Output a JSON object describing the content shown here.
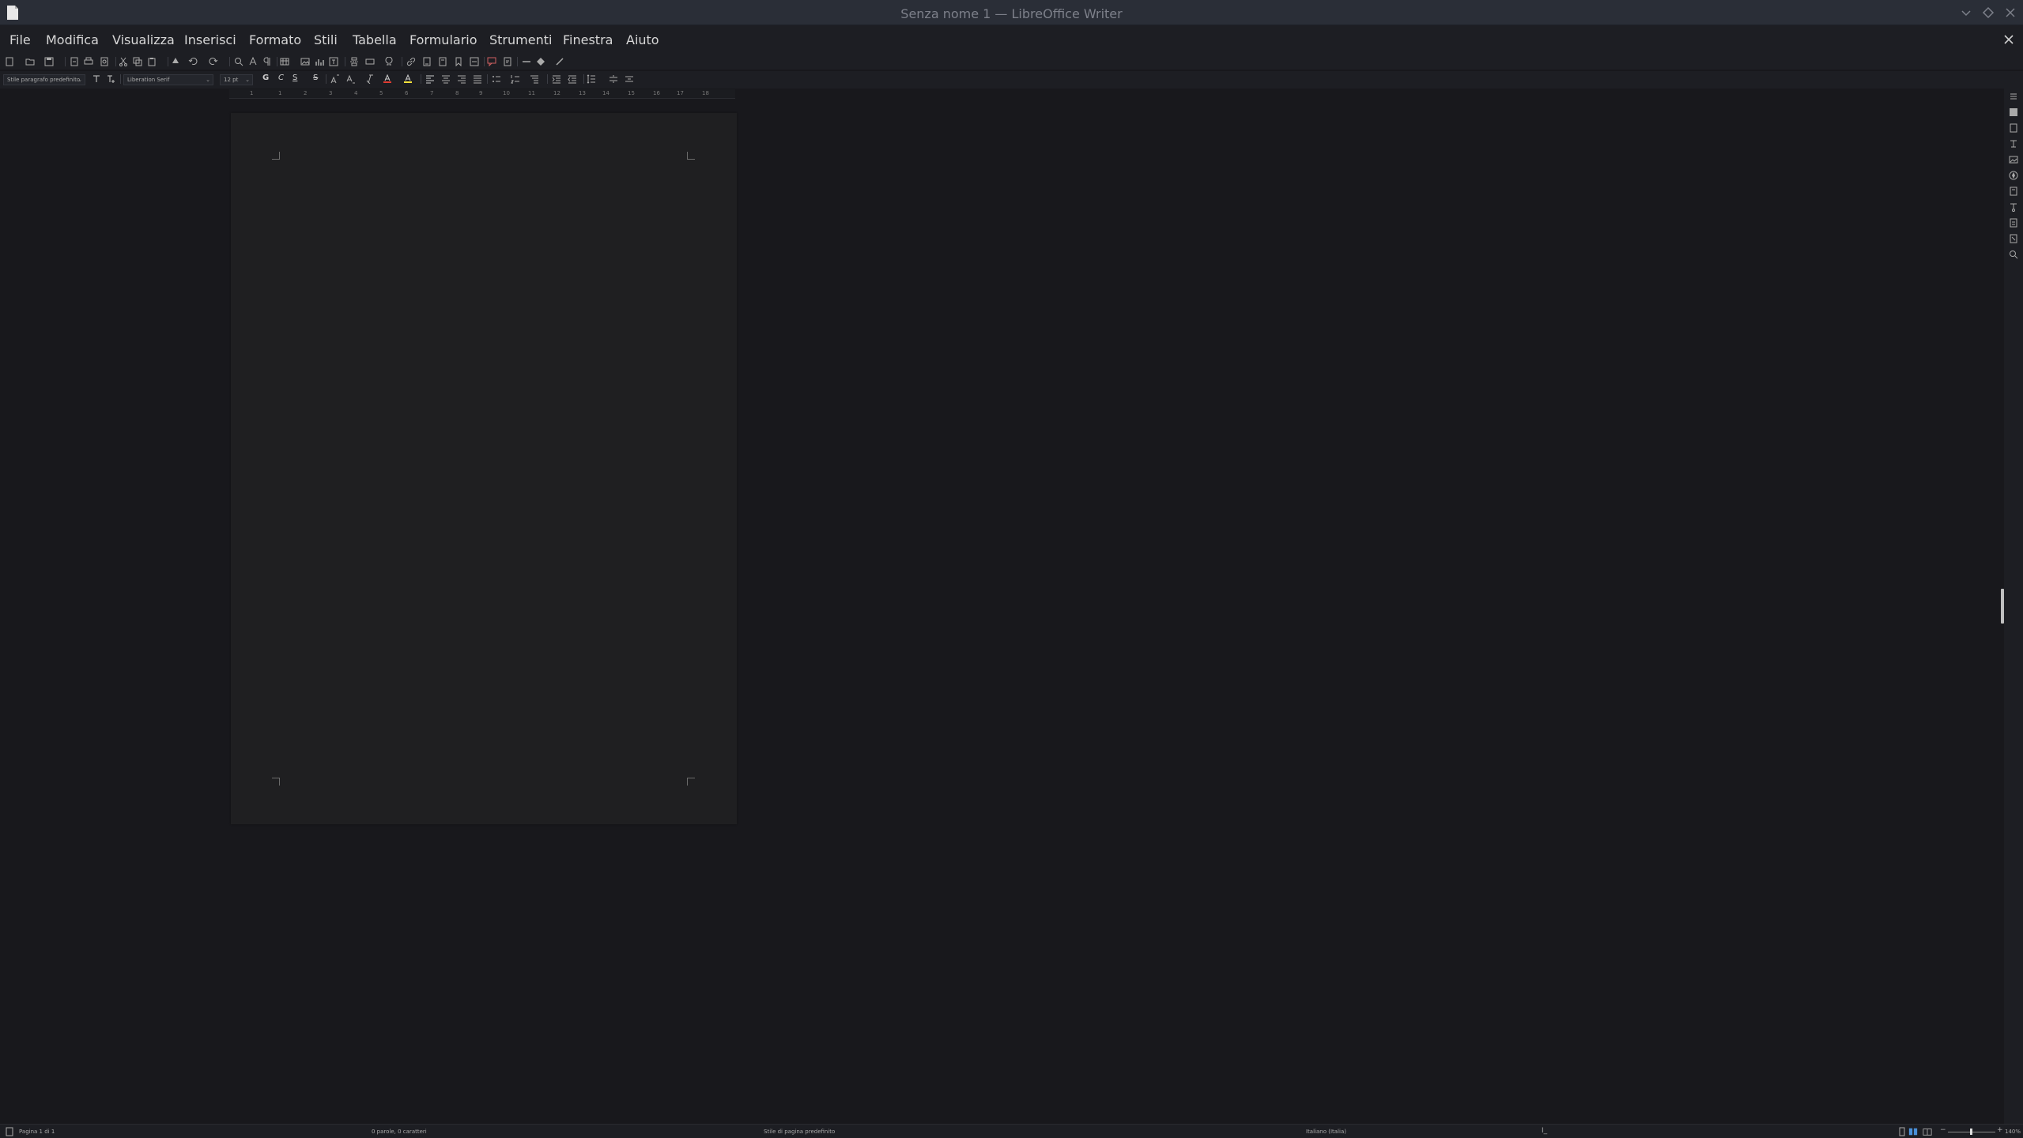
{
  "window": {
    "title": "Senza nome 1 — LibreOffice Writer"
  },
  "menu": {
    "items": [
      "File",
      "Modifica",
      "Visualizza",
      "Inserisci",
      "Formato",
      "Stili",
      "Tabella",
      "Formulario",
      "Strumenti",
      "Finestra",
      "Aiuto"
    ]
  },
  "formatting": {
    "paragraph_style": "Stile paragrafo predefinito",
    "font_name": "Liberation Serif",
    "font_size": "12 pt",
    "bold": "G",
    "italic": "C",
    "underline": "S",
    "strikethrough": "S"
  },
  "ruler": {
    "labels": [
      "1",
      "1",
      "2",
      "3",
      "4",
      "5",
      "6",
      "7",
      "8",
      "9",
      "10",
      "11",
      "12",
      "13",
      "14",
      "15",
      "16",
      "17",
      "18"
    ]
  },
  "status": {
    "page": "Pagina 1 di 1",
    "words": "0 parole, 0 caratteri",
    "page_style": "Stile di pagina predefinito",
    "language": "Italiano (Italia)",
    "zoom": "140%"
  },
  "colors": {
    "titlebar": "#2a2e37",
    "menubar": "#1d1e23",
    "document_background": "#18181c",
    "page": "#1f1f21",
    "font_color_accent": "#e03c31",
    "highlight_accent": "#f4e23c"
  }
}
